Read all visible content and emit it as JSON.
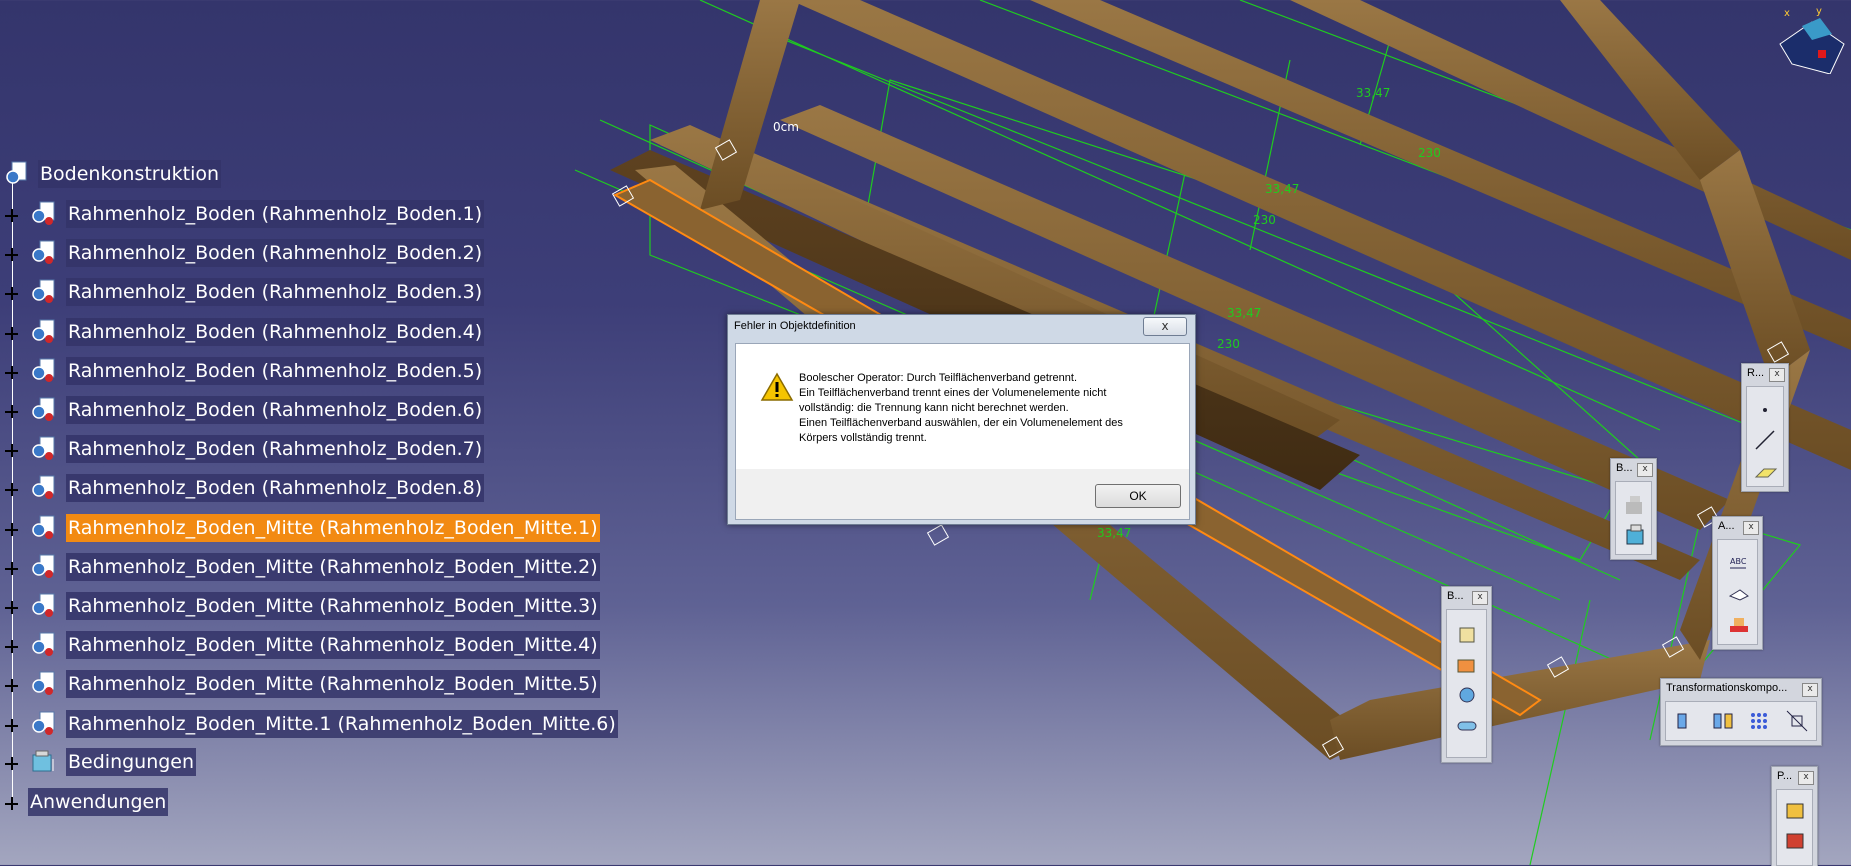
{
  "tree": {
    "root": {
      "label": "Bodenkonstruktion"
    },
    "items": [
      {
        "label": "Rahmenholz_Boden (Rahmenholz_Boden.1)",
        "selected": false
      },
      {
        "label": "Rahmenholz_Boden (Rahmenholz_Boden.2)",
        "selected": false
      },
      {
        "label": "Rahmenholz_Boden (Rahmenholz_Boden.3)",
        "selected": false
      },
      {
        "label": "Rahmenholz_Boden (Rahmenholz_Boden.4)",
        "selected": false
      },
      {
        "label": "Rahmenholz_Boden (Rahmenholz_Boden.5)",
        "selected": false
      },
      {
        "label": "Rahmenholz_Boden (Rahmenholz_Boden.6)",
        "selected": false
      },
      {
        "label": "Rahmenholz_Boden (Rahmenholz_Boden.7)",
        "selected": false
      },
      {
        "label": "Rahmenholz_Boden (Rahmenholz_Boden.8)",
        "selected": false
      },
      {
        "label": "Rahmenholz_Boden_Mitte (Rahmenholz_Boden_Mitte.1)",
        "selected": true
      },
      {
        "label": "Rahmenholz_Boden_Mitte (Rahmenholz_Boden_Mitte.2)",
        "selected": false
      },
      {
        "label": "Rahmenholz_Boden_Mitte (Rahmenholz_Boden_Mitte.3)",
        "selected": false
      },
      {
        "label": "Rahmenholz_Boden_Mitte (Rahmenholz_Boden_Mitte.4)",
        "selected": false
      },
      {
        "label": "Rahmenholz_Boden_Mitte (Rahmenholz_Boden_Mitte.5)",
        "selected": false
      },
      {
        "label": "Rahmenholz_Boden_Mitte.1 (Rahmenholz_Boden_Mitte.6)",
        "selected": false
      }
    ],
    "constraints": {
      "label": "Bedingungen"
    },
    "applications": {
      "label": "Anwendungen"
    }
  },
  "dialog": {
    "title": "Fehler in Objektdefinition",
    "close_label": "x",
    "icon": "warning-icon",
    "lines": [
      "Boolescher Operator: Durch Teilflächenverband getrennt.",
      "Ein Teilflächenverband trennt eines der Volumenelemente nicht",
      "vollständig: die Trennung kann nicht berechnet werden.",
      "Einen Teilflächenverband auswählen, der ein Volumenelement des",
      "Körpers vollständig trennt."
    ],
    "ok_label": "OK"
  },
  "dimensions": {
    "d1": "33,47",
    "d2": "230",
    "d3": "33,47",
    "d4": "230",
    "d5": "33,47",
    "d6": "230",
    "d7": "33,47",
    "offset": "0cm"
  },
  "toolbars": {
    "r": {
      "title": "R...",
      "close": "x"
    },
    "b_small": {
      "title": "B...",
      "close": "x"
    },
    "a": {
      "title": "A...",
      "close": "x"
    },
    "b_tall": {
      "title": "B...",
      "close": "x"
    },
    "transform": {
      "title": "Transformationskompo...",
      "close": "x"
    },
    "p": {
      "title": "P...",
      "close": "x"
    }
  },
  "colors": {
    "background_top": "#34356c",
    "selection": "#f28a12",
    "dimension_green": "#1fcc1f",
    "wood": "#7a5a2c"
  }
}
